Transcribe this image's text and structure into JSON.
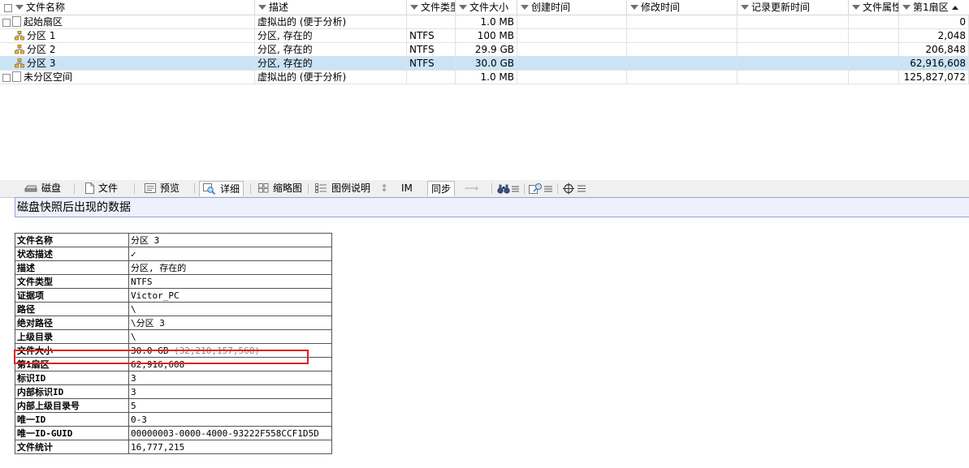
{
  "columns": {
    "name": "文件名称",
    "desc": "描述",
    "type": "文件类型",
    "size": "文件大小",
    "created": "创建时间",
    "modified": "修改时间",
    "record_updated": "记录更新时间",
    "attr": "文件属性",
    "first_sector": "第1扇区"
  },
  "rows": [
    {
      "name": "起始扇区",
      "desc": "虚拟出的 (便于分析)",
      "type": "",
      "size": "1.0 MB",
      "created": "",
      "modified": "",
      "record_updated": "",
      "attr": "",
      "first_sector": "0",
      "icon": "file-icon"
    },
    {
      "name": "分区 1",
      "desc": "分区, 存在的",
      "type": "NTFS",
      "size": "100 MB",
      "created": "",
      "modified": "",
      "record_updated": "",
      "attr": "",
      "first_sector": "2,048",
      "icon": "partition-icon"
    },
    {
      "name": "分区 2",
      "desc": "分区, 存在的",
      "type": "NTFS",
      "size": "29.9 GB",
      "created": "",
      "modified": "",
      "record_updated": "",
      "attr": "",
      "first_sector": "206,848",
      "icon": "partition-icon"
    },
    {
      "name": "分区 3",
      "desc": "分区, 存在的",
      "type": "NTFS",
      "size": "30.0 GB",
      "created": "",
      "modified": "",
      "record_updated": "",
      "attr": "",
      "first_sector": "62,916,608",
      "icon": "partition-icon",
      "selected": true
    },
    {
      "name": "未分区空间",
      "desc": "虚拟出的 (便于分析)",
      "type": "",
      "size": "1.0 MB",
      "created": "",
      "modified": "",
      "record_updated": "",
      "attr": "",
      "first_sector": "125,827,072",
      "icon": "file-icon"
    }
  ],
  "tabs": {
    "disk": "磁盘",
    "file": "文件",
    "preview": "预览",
    "details": "详细",
    "thumbnails": "缩略图",
    "legend": "图例说明",
    "im": "IM",
    "sync": "同步"
  },
  "details": {
    "banner": "磁盘快照后出现的数据",
    "props": [
      {
        "key": "文件名称",
        "value": "分区 3"
      },
      {
        "key": "状态描述",
        "value": "✓"
      },
      {
        "key": "描述",
        "value": "分区, 存在的"
      },
      {
        "key": "文件类型",
        "value": "NTFS"
      },
      {
        "key": "证据项",
        "value": "Victor_PC"
      },
      {
        "key": "路径",
        "value": "\\"
      },
      {
        "key": "绝对路径",
        "value": "\\分区 3"
      },
      {
        "key": "上级目录",
        "value": "\\"
      },
      {
        "key": "文件大小",
        "value": "30.0 GB",
        "extra": "(32,210,157,568)"
      },
      {
        "key": "第1扇区",
        "value": "62,916,608"
      },
      {
        "key": "标识ID",
        "value": "3"
      },
      {
        "key": "内部标识ID",
        "value": "3"
      },
      {
        "key": "内部上级目录号",
        "value": "5"
      },
      {
        "key": "唯一ID",
        "value": "0-3"
      },
      {
        "key": "唯一ID-GUID",
        "value": "00000003-0000-4000-93222F558CCF1D5D"
      },
      {
        "key": "文件统计",
        "value": "16,777,215"
      }
    ]
  },
  "colors": {
    "selection": "#cbe3f7",
    "highlight_box": "#e02020",
    "banner_bg": "#eef0fb"
  }
}
